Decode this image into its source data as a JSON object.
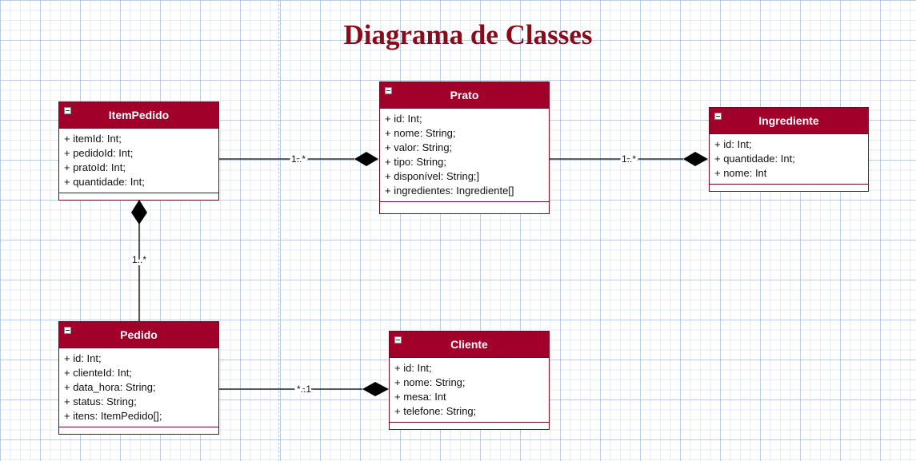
{
  "diagram": {
    "title": "Diagrama de Classes",
    "colors": {
      "title": "#8b0a1a",
      "class_header": "#a0002a",
      "class_border": "#6e0c1d",
      "line": "#000000"
    },
    "classes": {
      "item_pedido": {
        "name": "ItemPedido",
        "attributes": [
          "+ itemId: Int;",
          "+ pedidoId: Int;",
          "+ pratoId: Int;",
          "+ quantidade: Int;"
        ]
      },
      "prato": {
        "name": "Prato",
        "attributes": [
          "+ id: Int;",
          "+ nome: String;",
          "+ valor: String;",
          "+ tipo: String;",
          "+ disponível: String;]",
          "+ ingredientes: Ingrediente[]"
        ]
      },
      "ingrediente": {
        "name": "Ingrediente",
        "attributes": [
          "+ id: Int;",
          "+ quantidade: Int;",
          "+ nome: Int"
        ]
      },
      "pedido": {
        "name": "Pedido",
        "attributes": [
          "+ id: Int;",
          "+ clienteId: Int;",
          "+ data_hora: String;",
          "+ status: String;",
          "+ itens: ItemPedido[];"
        ]
      },
      "cliente": {
        "name": "Cliente",
        "attributes": [
          "+ id: Int;",
          "+ nome: String;",
          "+ mesa: Int",
          "+ telefone: String;"
        ]
      }
    },
    "relations": {
      "itempedido_prato": {
        "from": "ItemPedido",
        "to": "Prato",
        "type": "composition",
        "multiplicity": "1..*"
      },
      "prato_ingrediente": {
        "from": "Prato",
        "to": "Ingrediente",
        "type": "composition",
        "multiplicity": "1..*"
      },
      "pedido_itempedido": {
        "from": "Pedido",
        "to": "ItemPedido",
        "type": "composition",
        "multiplicity": "1..*"
      },
      "pedido_cliente": {
        "from": "Pedido",
        "to": "Cliente",
        "type": "composition",
        "multiplicity": "*..1"
      }
    }
  }
}
